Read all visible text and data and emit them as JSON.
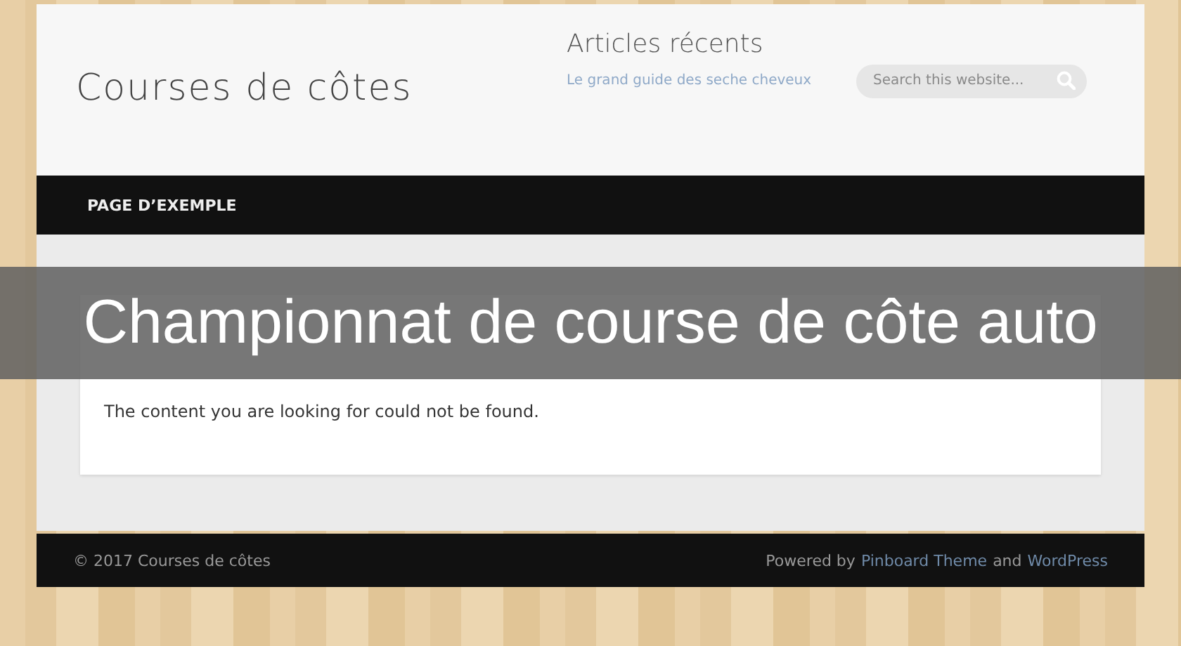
{
  "header": {
    "site_title": "Courses de côtes",
    "widget_title": "Articles récents",
    "recent_posts": [
      "Le grand guide des seche cheveux"
    ],
    "search": {
      "placeholder": "Search this website..."
    }
  },
  "nav": {
    "items": [
      {
        "label": "PAGE D’EXEMPLE",
        "selected": false
      }
    ]
  },
  "overlay_banner": "Championnat de course de côte auto",
  "content": {
    "message": "The content you are looking for could not be found."
  },
  "footer": {
    "copyright": "© 2017 Courses de côtes",
    "powered_prefix": "Powered by",
    "theme_link": "Pinboard Theme",
    "joiner": "and",
    "platform_link": "WordPress"
  }
}
